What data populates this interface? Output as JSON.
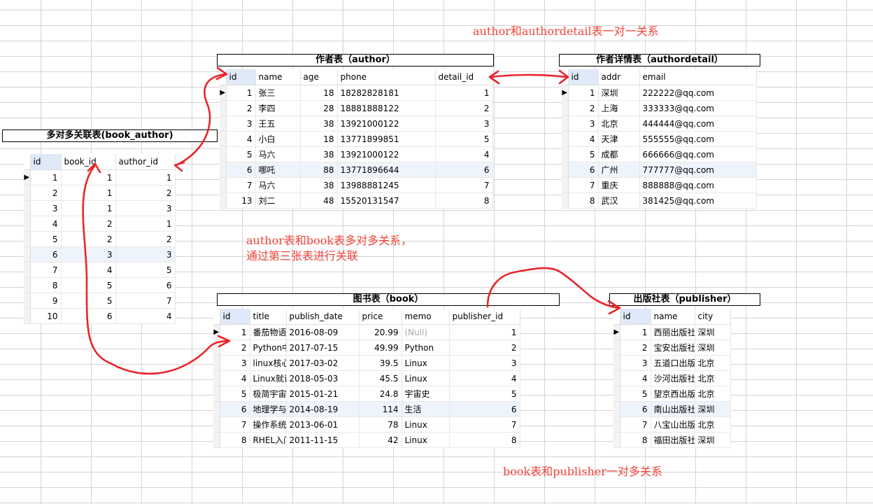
{
  "titles": {
    "author": "作者表（author）",
    "authordetail": "作者详情表（authordetail）",
    "book_author": "多对多关联表(book_author)",
    "book": "图书表（book）",
    "publisher": "出版社表（publisher）"
  },
  "notes": {
    "one_to_one": "author和authordetail表一对一关系",
    "many_to_many_line1": "author表和book表多对多关系，",
    "many_to_many_line2": "通过第三张表进行关联",
    "one_to_many": "book表和publisher一对多关系"
  },
  "null_text": "(Null)",
  "colors": {
    "annotation_red": "#f0443a",
    "selected_header": "#dfe9f7",
    "grid_line": "#d4d4d4"
  },
  "tables": {
    "author": {
      "columns": [
        "id",
        "name",
        "age",
        "phone",
        "detail_id"
      ],
      "rows": [
        [
          "1",
          "张三",
          "18",
          "18282828181",
          "1"
        ],
        [
          "2",
          "李四",
          "28",
          "18881888122",
          "2"
        ],
        [
          "3",
          "王五",
          "38",
          "13921000122",
          "3"
        ],
        [
          "4",
          "小白",
          "18",
          "13771899851",
          "5"
        ],
        [
          "5",
          "马六",
          "38",
          "13921000122",
          "4"
        ],
        [
          "6",
          "哪吒",
          "88",
          "13771896644",
          "6"
        ],
        [
          "7",
          "马六",
          "38",
          "13988881245",
          "7"
        ],
        [
          "13",
          "刘二",
          "48",
          "15520131547",
          "8"
        ]
      ]
    },
    "authordetail": {
      "columns": [
        "id",
        "addr",
        "email"
      ],
      "rows": [
        [
          "1",
          "深圳",
          "222222@qq.com"
        ],
        [
          "2",
          "上海",
          "333333@qq.com"
        ],
        [
          "3",
          "北京",
          "444444@qq.com"
        ],
        [
          "4",
          "天津",
          "555555@qq.com"
        ],
        [
          "5",
          "成都",
          "666666@qq.com"
        ],
        [
          "6",
          "广州",
          "777777@qq.com"
        ],
        [
          "7",
          "重庆",
          "888888@qq.com"
        ],
        [
          "8",
          "武汉",
          "381425@qq.com"
        ]
      ]
    },
    "book_author": {
      "columns": [
        "id",
        "book_id",
        "author_id"
      ],
      "rows": [
        [
          "1",
          "1",
          "1"
        ],
        [
          "2",
          "1",
          "2"
        ],
        [
          "3",
          "1",
          "3"
        ],
        [
          "4",
          "2",
          "1"
        ],
        [
          "5",
          "2",
          "2"
        ],
        [
          "6",
          "3",
          "3"
        ],
        [
          "7",
          "4",
          "5"
        ],
        [
          "8",
          "5",
          "6"
        ],
        [
          "9",
          "5",
          "7"
        ],
        [
          "10",
          "6",
          "4"
        ]
      ]
    },
    "book": {
      "columns": [
        "id",
        "title",
        "publish_date",
        "price",
        "memo",
        "publisher_id"
      ],
      "rows": [
        [
          "1",
          "番茄物语",
          "2016-08-09",
          "20.99",
          "(Null)",
          "1"
        ],
        [
          "2",
          "Python中",
          "2017-07-15",
          "49.99",
          "Python",
          "2"
        ],
        [
          "3",
          "linux核心",
          "2017-03-02",
          "39.5",
          "Linux",
          "3"
        ],
        [
          "4",
          "Linux就误",
          "2018-05-03",
          "45.5",
          "Linux",
          "4"
        ],
        [
          "5",
          "极简宇宙",
          "2015-01-21",
          "24.8",
          "宇宙史",
          "5"
        ],
        [
          "6",
          "地理学与",
          "2014-08-19",
          "114",
          "生活",
          "6"
        ],
        [
          "7",
          "操作系统",
          "2013-06-01",
          "78",
          "Linux",
          "7"
        ],
        [
          "8",
          "RHEL入门",
          "2011-11-15",
          "42",
          "Linux",
          "8"
        ]
      ]
    },
    "publisher": {
      "columns": [
        "id",
        "name",
        "city"
      ],
      "rows": [
        [
          "1",
          "西丽出版社",
          "深圳"
        ],
        [
          "2",
          "宝安出版社",
          "深圳"
        ],
        [
          "3",
          "五道口出版",
          "北京"
        ],
        [
          "4",
          "沙河出版社",
          "北京"
        ],
        [
          "5",
          "望京西出版",
          "北京"
        ],
        [
          "6",
          "南山出版社",
          "深圳"
        ],
        [
          "7",
          "八宝山出版",
          "北京"
        ],
        [
          "8",
          "福田出版社",
          "深圳"
        ]
      ]
    }
  }
}
